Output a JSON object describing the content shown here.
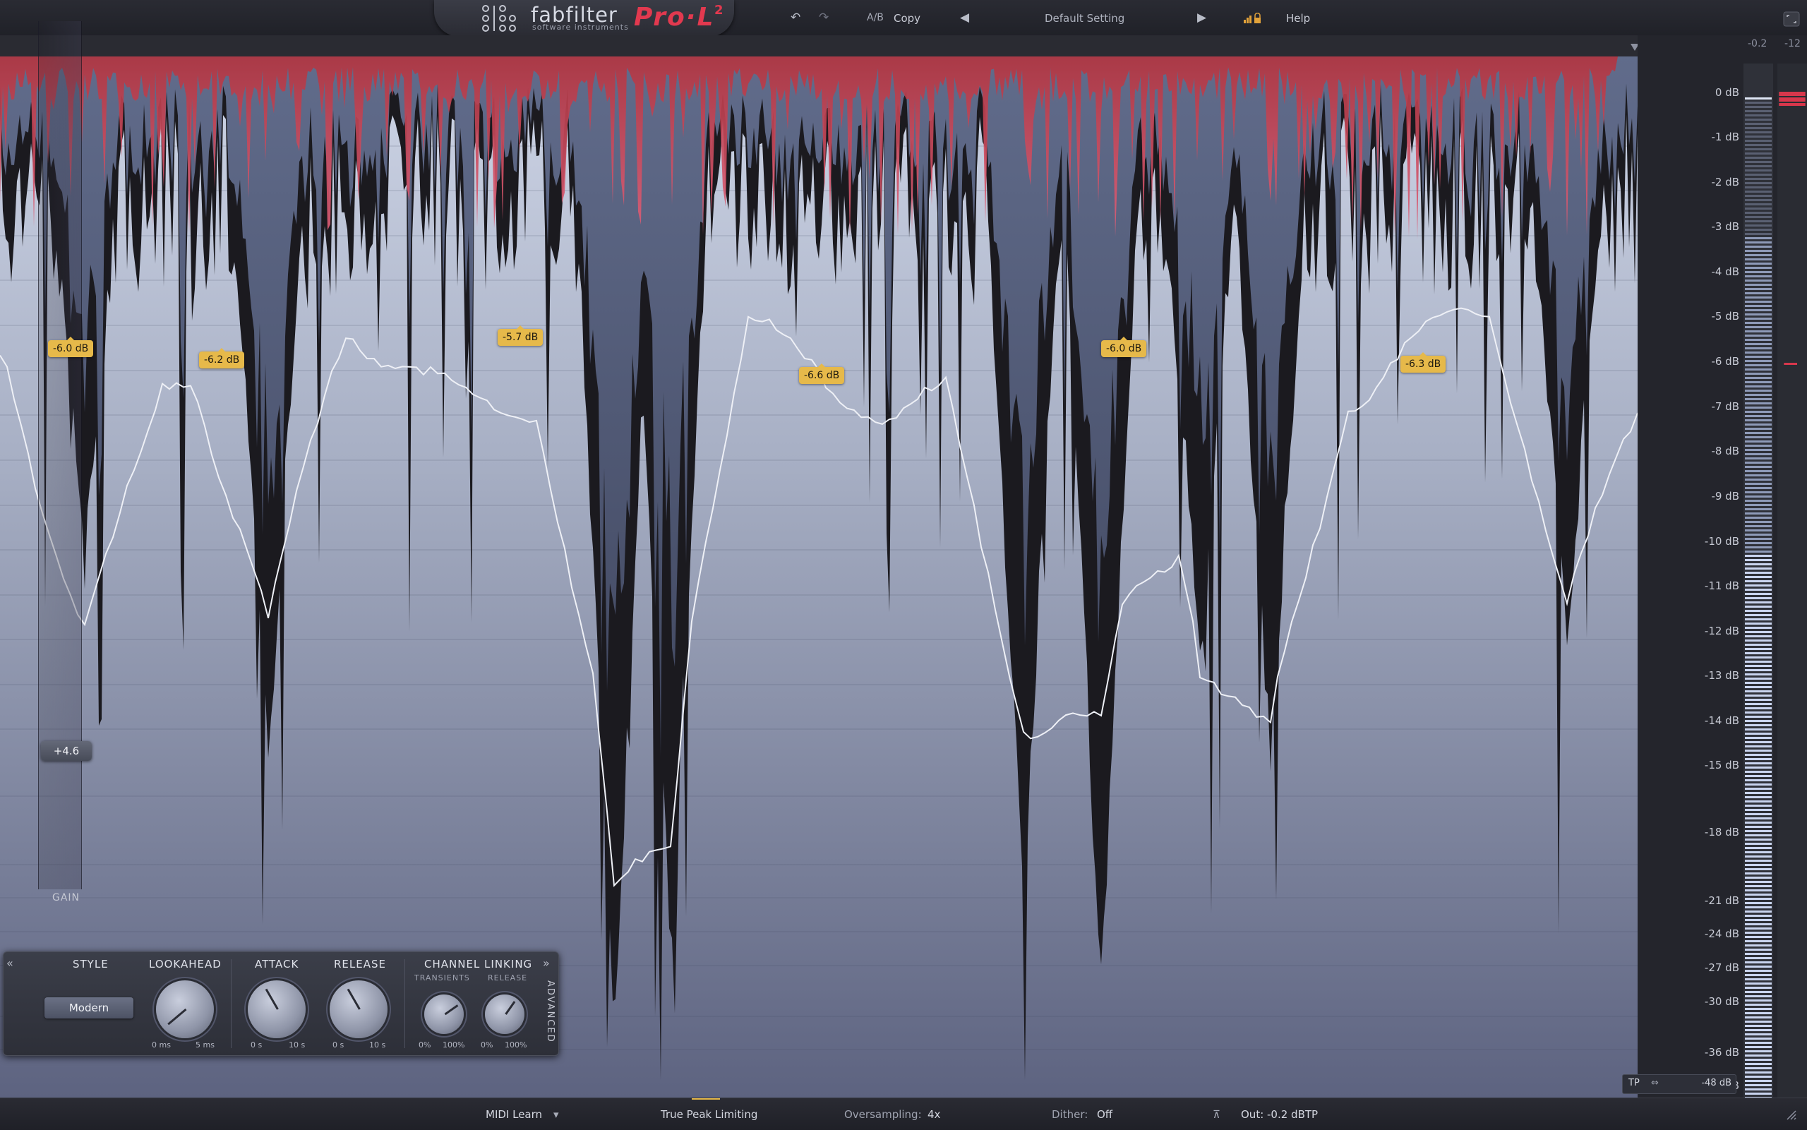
{
  "topbar": {
    "brand": "fabfilter",
    "brand_sub": "software instruments",
    "product": "Pro·L",
    "product_sup": "2",
    "undo_icon": "undo-icon",
    "redo_icon": "redo-icon",
    "ab_label": "A/B",
    "copy_label": "Copy",
    "preset_name": "Default Setting",
    "help_label": "Help"
  },
  "scale": {
    "labels": [
      "0 dB",
      "-1 dB",
      "-2 dB",
      "-3 dB",
      "-4 dB",
      "-5 dB",
      "-6 dB",
      "-7 dB",
      "-8 dB",
      "-9 dB",
      "-10 dB",
      "-11 dB",
      "-12 dB",
      "-13 dB",
      "-14 dB",
      "-15 dB",
      "-18 dB",
      "-21 dB",
      "-24 dB",
      "-27 dB",
      "-30 dB",
      "-36 dB",
      "-42 dB"
    ],
    "peak_left": "-0.2",
    "peak_right": "-12"
  },
  "reductions": [
    "-6.0 dB",
    "-6.2 dB",
    "-5.7 dB",
    "-6.6 dB",
    "-6.0 dB",
    "-6.3 dB"
  ],
  "gain": {
    "value": "+4.6",
    "label": "GAIN"
  },
  "panel": {
    "style_header": "STYLE",
    "style_value": "Modern",
    "lookahead_header": "LOOKAHEAD",
    "lookahead_min": "0 ms",
    "lookahead_max": "5 ms",
    "attack_header": "ATTACK",
    "attack_min": "0 s",
    "attack_max": "10 s",
    "release_header": "RELEASE",
    "release_min": "0 s",
    "release_max": "10 s",
    "linking_header": "CHANNEL LINKING",
    "transients_label": "TRANSIENTS",
    "linking_release_label": "RELEASE",
    "t_min": "0%",
    "t_max": "100%",
    "r_min": "0%",
    "r_max": "100%",
    "advanced_label": "ADVANCED"
  },
  "bottombar": {
    "midi_learn": "MIDI Learn",
    "true_peak": "True Peak Limiting",
    "oversampling_label": "Oversampling:",
    "oversampling_value": "4x",
    "dither_label": "Dither:",
    "dither_value": "Off",
    "out_label": "Out: -0.2 dBTP"
  },
  "meter_footer": {
    "tp_label": "TP",
    "range_value": "-48 dB"
  },
  "colors": {
    "accent_red": "#e2394f",
    "badge": "#e6b94a",
    "wave_light": "#a9b6d8"
  }
}
